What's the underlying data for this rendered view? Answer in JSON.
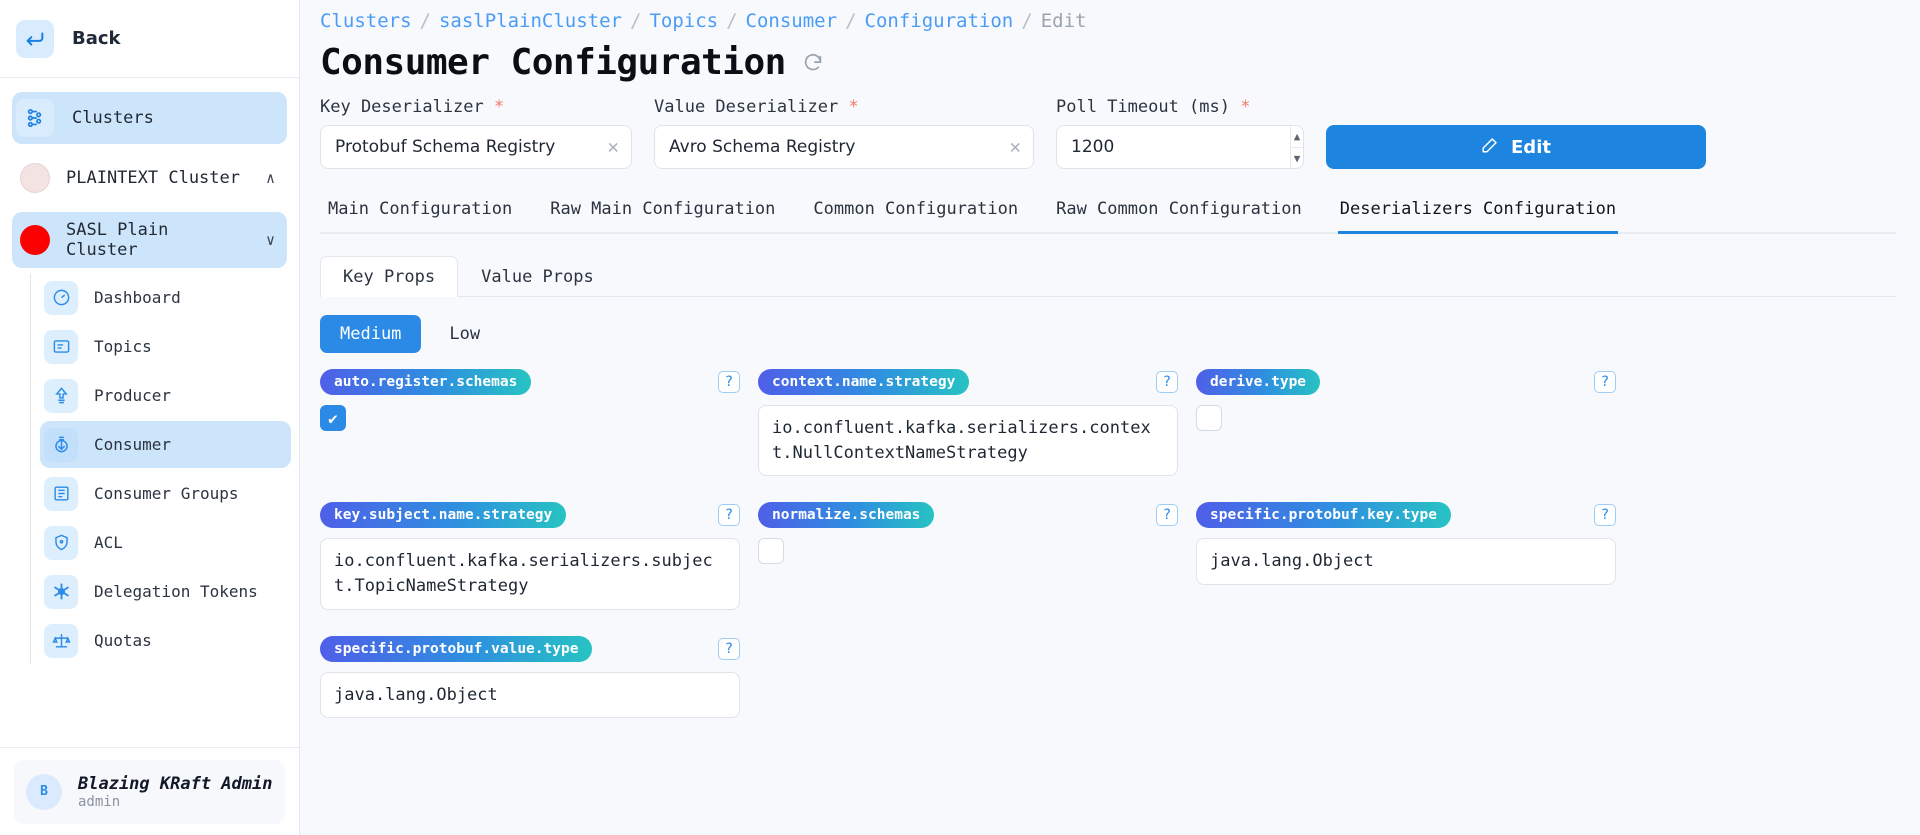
{
  "sidebar": {
    "back_label": "Back",
    "back_icon": "arrow-left-enter-icon",
    "clusters_label": "Clusters",
    "clusters_icon": "cluster-nodes-icon",
    "clusters": [
      {
        "name": "PLAINTEXT Cluster",
        "chevron": "∧",
        "status_color": "#f3e3e2",
        "active": false
      },
      {
        "name": "SASL Plain Cluster",
        "chevron": "∨",
        "status_color": "#fa0202",
        "active": true
      }
    ],
    "items": [
      {
        "label": "Dashboard",
        "icon": "gauge-icon",
        "active": false
      },
      {
        "label": "Topics",
        "icon": "folder-list-icon",
        "active": false
      },
      {
        "label": "Producer",
        "icon": "upload-arrow-icon",
        "active": false
      },
      {
        "label": "Consumer",
        "icon": "download-arrow-icon",
        "active": true
      },
      {
        "label": "Consumer Groups",
        "icon": "groups-icon",
        "active": false
      },
      {
        "label": "ACL",
        "icon": "shield-icon",
        "active": false
      },
      {
        "label": "Delegation Tokens",
        "icon": "asterisk-icon",
        "active": false
      },
      {
        "label": "Quotas",
        "icon": "scales-icon",
        "active": false
      }
    ],
    "user": {
      "initial": "B",
      "name": "Blazing KRaft Admin",
      "role": "admin"
    }
  },
  "breadcrumb": {
    "separator": "/",
    "items": [
      "Clusters",
      "saslPlainCluster",
      "Topics",
      "Consumer",
      "Configuration",
      "Edit"
    ]
  },
  "header": {
    "title": "Consumer Configuration",
    "refresh_icon": "refresh-icon"
  },
  "form": {
    "key_deserializer": {
      "label": "Key Deserializer",
      "required": "*",
      "value": "Protobuf Schema Registry",
      "clear_icon": "close-icon"
    },
    "value_deserializer": {
      "label": "Value Deserializer",
      "required": "*",
      "value": "Avro Schema Registry",
      "clear_icon": "close-icon"
    },
    "poll_timeout": {
      "label": "Poll Timeout (ms)",
      "required": "*",
      "value": "1200",
      "up_icon": "chevron-up-icon",
      "down_icon": "chevron-down-icon"
    },
    "edit_button": {
      "label": "Edit",
      "icon": "pencil-icon"
    }
  },
  "tabs": [
    {
      "label": "Main Configuration",
      "active": false
    },
    {
      "label": "Raw Main Configuration",
      "active": false
    },
    {
      "label": "Common Configuration",
      "active": false
    },
    {
      "label": "Raw Common Configuration",
      "active": false
    },
    {
      "label": "Deserializers Configuration",
      "active": true
    }
  ],
  "subtabs": [
    {
      "label": "Key Props",
      "active": true
    },
    {
      "label": "Value Props",
      "active": false
    }
  ],
  "importance": [
    {
      "label": "Medium",
      "active": true
    },
    {
      "label": "Low",
      "active": false
    }
  ],
  "help_glyph": "?",
  "check_glyph": "✔",
  "properties": [
    {
      "name": "auto.register.schemas",
      "type": "checkbox",
      "checked": true,
      "value": ""
    },
    {
      "name": "context.name.strategy",
      "type": "text",
      "checked": false,
      "value": "io.confluent.kafka.serializers.context.NullContextNameStrategy"
    },
    {
      "name": "derive.type",
      "type": "checkbox",
      "checked": false,
      "value": ""
    },
    {
      "name": "key.subject.name.strategy",
      "type": "text",
      "checked": false,
      "value": "io.confluent.kafka.serializers.subject.TopicNameStrategy"
    },
    {
      "name": "normalize.schemas",
      "type": "checkbox",
      "checked": false,
      "value": ""
    },
    {
      "name": "specific.protobuf.key.type",
      "type": "text",
      "checked": false,
      "value": "java.lang.Object"
    },
    {
      "name": "specific.protobuf.value.type",
      "type": "text",
      "checked": false,
      "value": "java.lang.Object"
    }
  ],
  "colors": {
    "accent": "#1d84e0",
    "badge_start": "#4f5fe8",
    "badge_end": "#27c3c3",
    "active_nav": "#cde5fb",
    "sasl_dot": "#fa0202"
  }
}
